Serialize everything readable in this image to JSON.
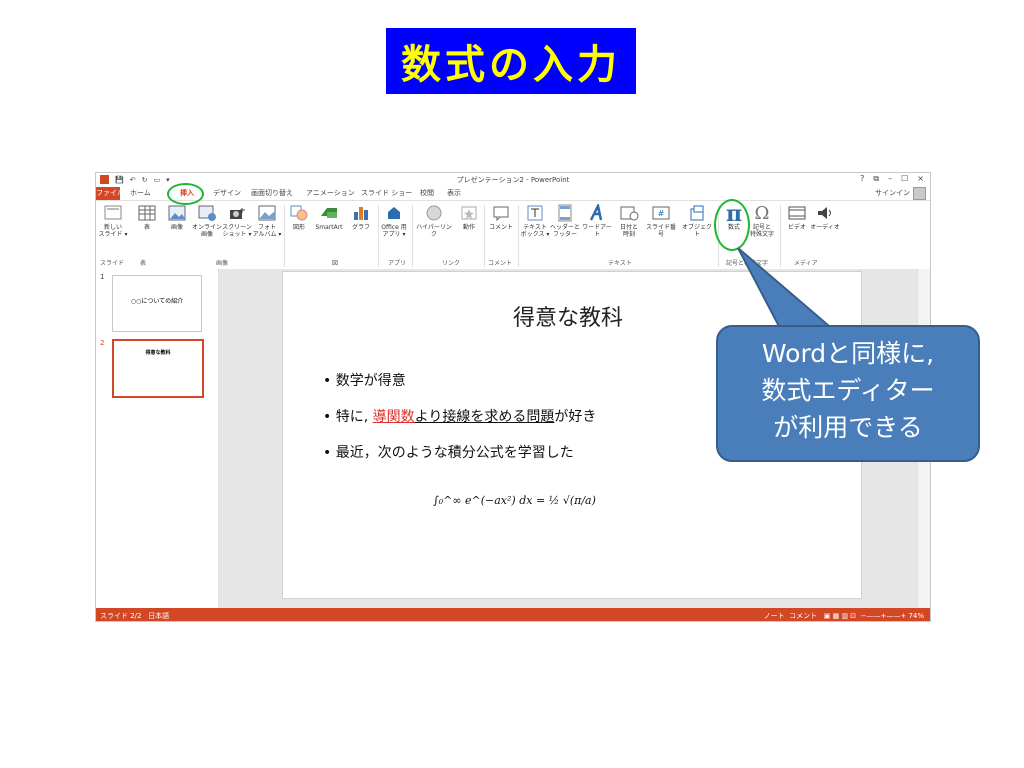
{
  "slide_title": "数式の入力",
  "app": {
    "window_title": "プレゼンテーション2 - PowerPoint",
    "window_controls": [
      "?",
      "⧉",
      "–",
      "☐",
      "×"
    ],
    "tabs": {
      "file": "ファイル",
      "home": "ホーム",
      "insert": "挿入",
      "design": "デザイン",
      "transitions": "画面切り替え",
      "animations": "アニメーション",
      "slideshow": "スライド ショー",
      "review": "校閲",
      "view": "表示"
    },
    "signin": "サインイン",
    "ribbon": {
      "new_slide": "新しい\nスライド ▾",
      "table": "表",
      "picture": "画像",
      "online_pictures": "オンライン\n画像",
      "screenshot": "スクリーン\nショット ▾",
      "photo_album": "フォト\nアルバム ▾",
      "shapes": "図形",
      "smartart": "SmartArt",
      "chart": "グラフ",
      "office_apps": "Office 用\nアプリ ▾",
      "hyperlink": "ハイパーリンク",
      "action": "動作",
      "comment": "コメント",
      "textbox": "テキスト\nボックス ▾",
      "header_footer": "ヘッダーと\nフッター",
      "wordart": "ワードアート",
      "date_time": "日付と\n時刻",
      "slide_number": "スライド番号",
      "object": "オブジェクト",
      "equation": "数式",
      "symbol": "記号と\n特殊文字",
      "video": "ビデオ",
      "audio": "オーディオ",
      "groups": {
        "slides": "スライド",
        "tables": "表",
        "images": "画像",
        "illustrations": "図",
        "apps": "アプリ",
        "links": "リンク",
        "comments": "コメント",
        "text": "テキスト",
        "symbols": "記号と特殊文字",
        "media": "メディア"
      }
    },
    "thumbnails": [
      {
        "number": "1",
        "title": "○○についての紹介"
      },
      {
        "number": "2",
        "title": "得意な教科"
      }
    ],
    "slide": {
      "title": "得意な教科",
      "bullet1": "数学が得意",
      "bullet2_prefix": "特に,",
      "bullet2_red": "導関数",
      "bullet2_mid": "より接線を求める",
      "bullet2_ul": "問題",
      "bullet2_suffix": "が好き",
      "bullet3": "最近，次のような積分公式を学習した",
      "formula": "∫₀^∞ e^(−ax²) dx = ½ √(π/a)"
    },
    "status": {
      "slide_count": "スライド 2/2",
      "language": "日本語",
      "notes": "ノート",
      "comments": "コメント",
      "zoom": "74%"
    }
  },
  "callout": {
    "line1": "Wordと同様に,",
    "line2": "数式エディター",
    "line3": "が利用できる"
  },
  "colors": {
    "title_bg": "#0000ff",
    "title_text": "#ffff00",
    "ppt_accent": "#d24726",
    "callout_fill": "#4a7ebb",
    "highlight_circle": "#1fb534"
  }
}
